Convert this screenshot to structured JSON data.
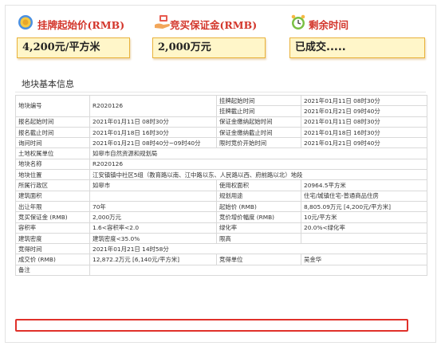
{
  "header": {
    "start_price_title": "挂牌起始价(RMB)",
    "start_price_value": "4,200元/平方米",
    "deposit_title": "竞买保证金(RMB)",
    "deposit_value": "2,000万元",
    "remaining_title": "剩余时间",
    "remaining_value": "已成交....."
  },
  "section_title": "地块基本信息",
  "rows": {
    "r0": {
      "k1": "地块编号",
      "v1": "R2020126",
      "k2a": "挂牌起始时间",
      "v2a": "2021年01月11日 08时30分",
      "k2b": "挂牌截止时间",
      "v2b": "2021年01月21日 09时40分"
    },
    "r1": {
      "k1": "报名起始时间",
      "v1": "2021年01月11日 08时30分",
      "k2": "保证金缴纳起始时间",
      "v2": "2021年01月11日 08时30分"
    },
    "r2": {
      "k1": "报名截止时间",
      "v1": "2021年01月18日 16时30分",
      "k2": "保证金缴纳截止时间",
      "v2": "2021年01月18日 16时30分"
    },
    "r3": {
      "k1": "询问时间",
      "v1": "2021年01月21日 08时40分~09时40分",
      "k2": "限时竞价开始时间",
      "v2": "2021年01月21日 09时40分"
    },
    "r4": {
      "k1": "土地权属单位",
      "v1": "如皋市自然资源和规划局"
    },
    "r5": {
      "k1": "地块名称",
      "v1": "R2020126"
    },
    "r6": {
      "k1": "地块位置",
      "v1": "江安镇镇中社区5组（教育路以南、江中路以东、人民路以西、府前路以北）地段"
    },
    "r7": {
      "k1": "所属行政区",
      "v1": "如皋市",
      "k2": "使用权面积",
      "v2": "20964.5平方米"
    },
    "r8": {
      "k1": "建筑面积",
      "v1": "",
      "k2": "规划用途",
      "v2": "住宅/城镇住宅-普通商品住房"
    },
    "r9": {
      "k1": "出让年限",
      "v1": "70年",
      "k2": "起始价 (RMB)",
      "v2": "8,805.09万元 [4,200元/平方米]"
    },
    "r10": {
      "k1": "竞买保证金 (RMB)",
      "v1": "2,000万元",
      "k2": "竞价增价幅度 (RMB)",
      "v2": "10元/平方米"
    },
    "r11": {
      "k1": "容积率",
      "v1": "1.6<容积率<2.0",
      "k2": "绿化率",
      "v2": "20.0%<绿化率"
    },
    "r12": {
      "k1": "建筑密度",
      "v1": "建筑密度<35.0%",
      "k2": "限高",
      "v2": ""
    },
    "r13": {
      "k1": "竞得时间",
      "v1": "2021年01月21日 14时58分"
    },
    "r14": {
      "k1": "成交价 (RMB)",
      "v1": "12,872.2万元 [6,140元/平方米]",
      "k2": "竞得单位",
      "v2": "吴金华"
    },
    "r15": {
      "k1": "备注",
      "v1": ""
    }
  },
  "colors": {
    "title_red": "#d3362b",
    "box_fill": "#fff6c9",
    "box_border": "#e9b23a",
    "highlight": "#e0312a"
  },
  "icons": [
    "coin-stack-icon",
    "hand-money-icon",
    "alarm-clock-icon"
  ]
}
